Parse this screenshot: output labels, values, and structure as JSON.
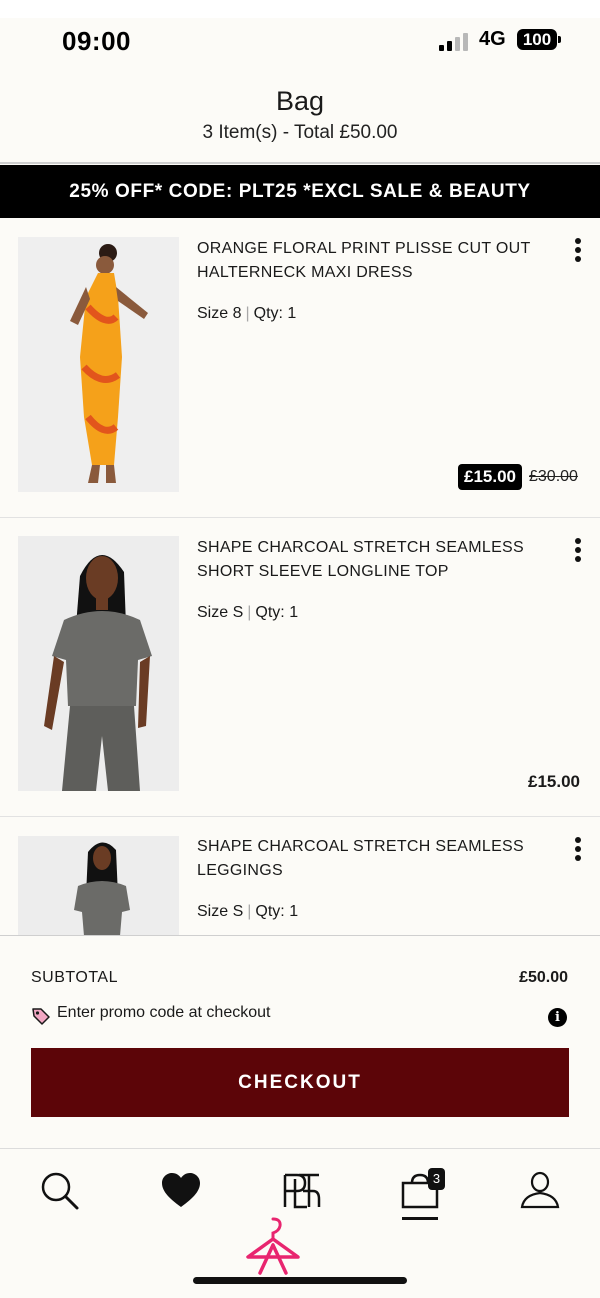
{
  "status_bar": {
    "time": "09:00",
    "network": "4G",
    "battery": "100"
  },
  "header": {
    "title": "Bag",
    "subtitle": "3 Item(s) - Total £50.00"
  },
  "promo_banner": "25% OFF* CODE: PLT25 *EXCL SALE & BEAUTY",
  "items": [
    {
      "name": "ORANGE FLORAL PRINT PLISSE CUT OUT HALTERNECK MAXI DRESS",
      "size": "Size 8",
      "separator": "|",
      "qty": "Qty: 1",
      "sale_price": "£15.00",
      "original_price": "£30.00"
    },
    {
      "name": "SHAPE CHARCOAL STRETCH SEAMLESS SHORT SLEEVE LONGLINE TOP",
      "size": "Size S",
      "separator": "|",
      "qty": "Qty: 1",
      "price": "£15.00"
    },
    {
      "name": "SHAPE CHARCOAL STRETCH SEAMLESS LEGGINGS",
      "size": "Size S",
      "separator": "|",
      "qty": "Qty: 1"
    }
  ],
  "summary": {
    "subtotal_label": "SUBTOTAL",
    "subtotal_value": "£50.00",
    "promo_hint": "Enter promo code at checkout",
    "info_glyph": "i",
    "checkout_label": "CHECKOUT"
  },
  "nav": {
    "bag_count": "3",
    "icons": [
      "search-icon",
      "heart-icon",
      "plt-logo-icon",
      "bag-icon",
      "account-icon"
    ]
  },
  "colors": {
    "background": "#fcfbf7",
    "banner": "#000000",
    "checkout": "#5c0508",
    "brand_pink": "#e8256f"
  }
}
